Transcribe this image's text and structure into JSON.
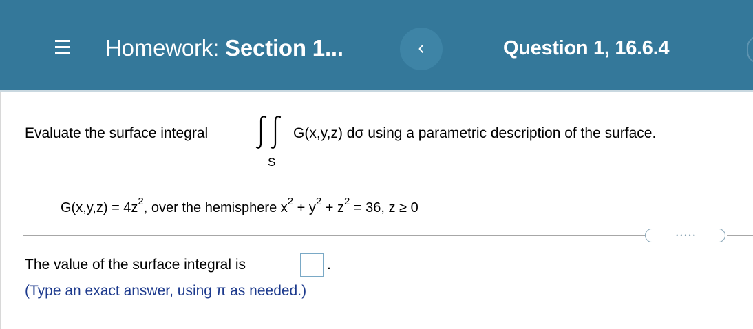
{
  "header": {
    "homework_label": "Homework:",
    "section_label": "Section 1...",
    "question_label": "Question 1, 16.6.4",
    "menu_icon": "hamburger-menu-icon",
    "back_icon": "chevron-left-icon",
    "background_color": "#34789a"
  },
  "question": {
    "prompt_before": "Evaluate the surface integral",
    "integral_symbol": "∬",
    "integral_subscript": "S",
    "prompt_after": "G(x,y,z) dσ using a parametric description of the surface.",
    "function_lhs": "G(x,y,z) = 4z",
    "exponent": "2",
    "over_text": ", over the hemisphere x",
    "plus_y": " + y",
    "plus_z": " + z",
    "equals_text": " = 36, z ≥ 0"
  },
  "answer": {
    "label": "The value of the surface integral is",
    "input_value": "",
    "end_punctuation": ".",
    "hint": "(Type an exact answer, using π as needed.)"
  },
  "more_button": {
    "label": "•••••"
  }
}
